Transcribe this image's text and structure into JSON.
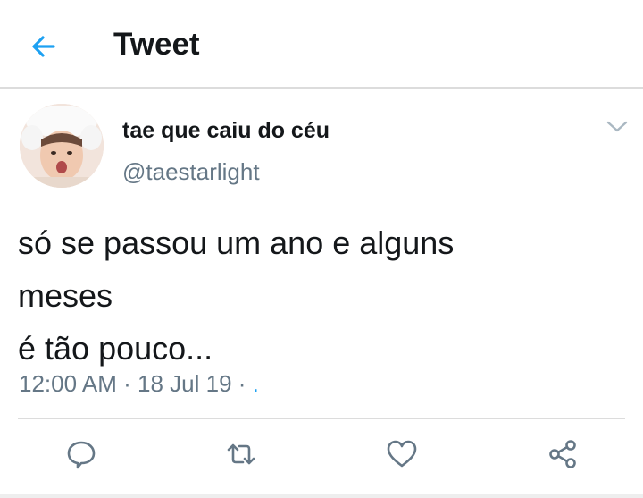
{
  "header": {
    "title": "Tweet"
  },
  "tweet": {
    "display_name": "tae que caiu do céu",
    "handle": "@taestarlight",
    "text_lines": [
      "só se passou um ano e alguns",
      "meses",
      "é tão pouco..."
    ],
    "time": "12:00 AM",
    "date": "18 Jul 19",
    "separator": "·",
    "trailing": "."
  },
  "icons": {
    "back": "arrow-left-icon",
    "more": "chevron-down-icon",
    "reply": "reply-icon",
    "retweet": "retweet-icon",
    "like": "heart-icon",
    "share": "share-icon"
  },
  "colors": {
    "accent": "#1da1f2",
    "secondary_text": "#657786",
    "icon": "#657786"
  }
}
